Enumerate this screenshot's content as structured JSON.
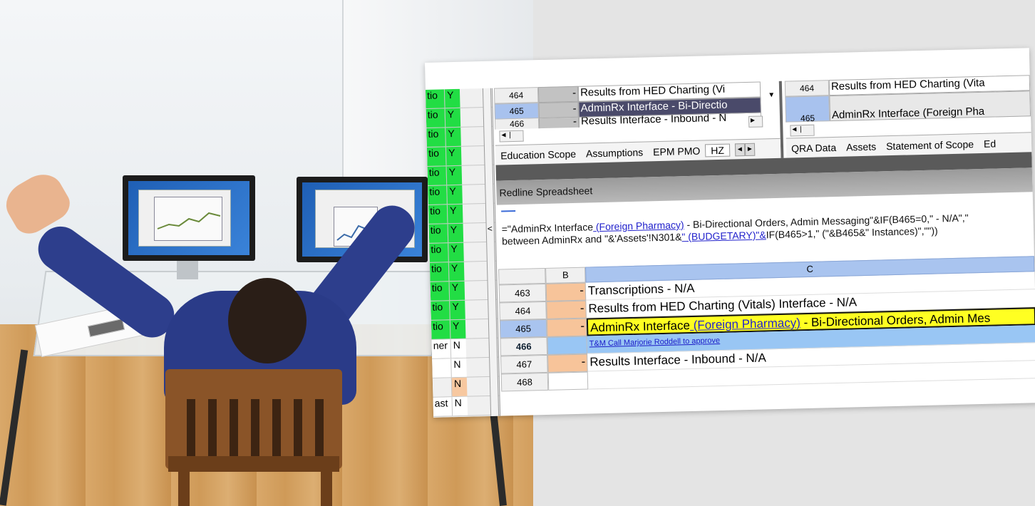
{
  "left_strip": {
    "rows": [
      {
        "a": "tio",
        "b": "Y",
        "style": "green"
      },
      {
        "a": "tio",
        "b": "Y",
        "style": "green"
      },
      {
        "a": "tio",
        "b": "Y",
        "style": "green"
      },
      {
        "a": "tio",
        "b": "Y",
        "style": "green"
      },
      {
        "a": "tio",
        "b": "Y",
        "style": "green"
      },
      {
        "a": "tio",
        "b": "Y",
        "style": "green"
      },
      {
        "a": "tio",
        "b": "Y",
        "style": "green"
      },
      {
        "a": "tio",
        "b": "Y",
        "style": "green"
      },
      {
        "a": "tio",
        "b": "Y",
        "style": "green"
      },
      {
        "a": "tio",
        "b": "Y",
        "style": "green"
      },
      {
        "a": "tio",
        "b": "Y",
        "style": "green"
      },
      {
        "a": "tio",
        "b": "Y",
        "style": "green"
      },
      {
        "a": "tio",
        "b": "Y",
        "style": "green"
      },
      {
        "a": "ner",
        "b": "N",
        "style": "white"
      },
      {
        "a": "",
        "b": "N",
        "style": "white"
      },
      {
        "a": "",
        "b": "N",
        "style": "peach"
      },
      {
        "a": "ast",
        "b": "N",
        "style": "white"
      }
    ],
    "splitter_arrow": "<"
  },
  "top_left_pane": {
    "rows": [
      {
        "num": "464",
        "b": "-",
        "c": "Results from HED Charting (Vi"
      },
      {
        "num": "465",
        "b": "-",
        "c": "AdminRx Interface - Bi-Directio"
      },
      {
        "num": "466",
        "b": "-",
        "c": "Results Interface - Inbound - N"
      }
    ],
    "tabs": [
      "Education Scope",
      "Assumptions",
      "EPM PMO",
      "HZ"
    ]
  },
  "top_right_pane": {
    "rows": [
      {
        "num": "464",
        "c": "Results from HED Charting (Vita"
      },
      {
        "num": "465",
        "c": "AdminRx Interface (Foreign Pha"
      }
    ],
    "tabs": [
      "QRA Data",
      "Assets",
      "Statement of Scope",
      "Ed"
    ]
  },
  "redline": {
    "title": "Redline Spreadsheet"
  },
  "formula": {
    "line1_pre": "=\"AdminRx Interface",
    "line1_link": " (Foreign Pharmacy)",
    "line1_post": " - Bi-Directional Orders, Admin Messaging\"&IF(B465=0,\" - N/A\",\"",
    "line2_pre": "between AdminRx and \"&'Assets'!N301&",
    "line2_link": "\" (BUDGETARY)\"&",
    "line2_post": "IF(B465>1,\" (\"&B465&\" Instances)\",\"\"))"
  },
  "grid": {
    "col_b": "B",
    "col_c": "C",
    "rows": [
      {
        "num": "463",
        "b": "-",
        "c": "Transcriptions - N/A",
        "style": "normal"
      },
      {
        "num": "464",
        "b": "-",
        "c": "Results from HED Charting (Vitals) Interface - N/A",
        "style": "normal"
      },
      {
        "num": "465",
        "b": "-",
        "c_pre": "AdminRx Interface",
        "c_link": " (Foreign Pharmacy)",
        "c_post": " - Bi-Directional Orders, Admin Mes",
        "style": "yellow"
      },
      {
        "num": "466",
        "b": "",
        "c": "T&M Call Marjorie Roddell to approve",
        "style": "blue"
      },
      {
        "num": "467",
        "b": "-",
        "c": "Results Interface - Inbound - N/A",
        "style": "normal"
      },
      {
        "num": "468",
        "b": "",
        "c": "",
        "style": "blank"
      }
    ]
  },
  "colors": {
    "green": "#22dd44",
    "peach": "#f7c49a",
    "selected_blue": "#a9c4ef",
    "highlight_yellow": "#ffff22"
  }
}
